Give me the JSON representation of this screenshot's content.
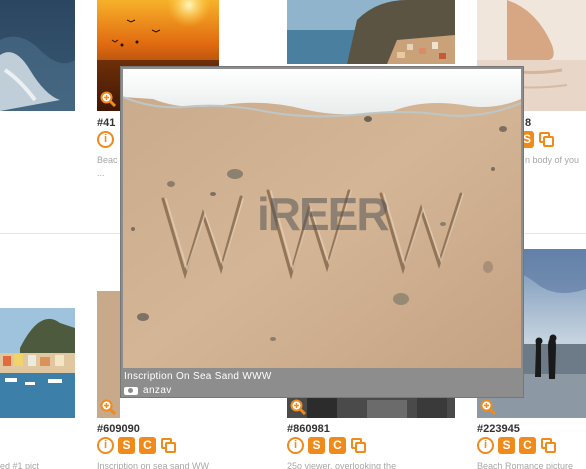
{
  "grid": {
    "items": [
      {
        "id": "",
        "desc": ""
      },
      {
        "id": "#41",
        "desc": "Beac"
      },
      {
        "id": "",
        "desc": ""
      },
      {
        "id": "8",
        "desc": "n body of you"
      },
      {
        "id": "",
        "desc": "ed #1 pict"
      },
      {
        "id": "#609090",
        "desc": "Inscription on sea sand WW"
      },
      {
        "id": "#860981",
        "desc": "25o viewer, overlooking the"
      },
      {
        "id": "#223945",
        "desc": "Beach Romance picture"
      }
    ],
    "desc_extra": "..."
  },
  "popup": {
    "caption": "Inscription On Sea Sand WWW",
    "author": "anzav",
    "watermark": "WWW",
    "overlay_mark": "iREER"
  },
  "icons": {
    "info": "i",
    "s": "S",
    "c": "C"
  },
  "colors": {
    "accent": "#f08a1a",
    "popup_bg": "#8d8d8d"
  }
}
